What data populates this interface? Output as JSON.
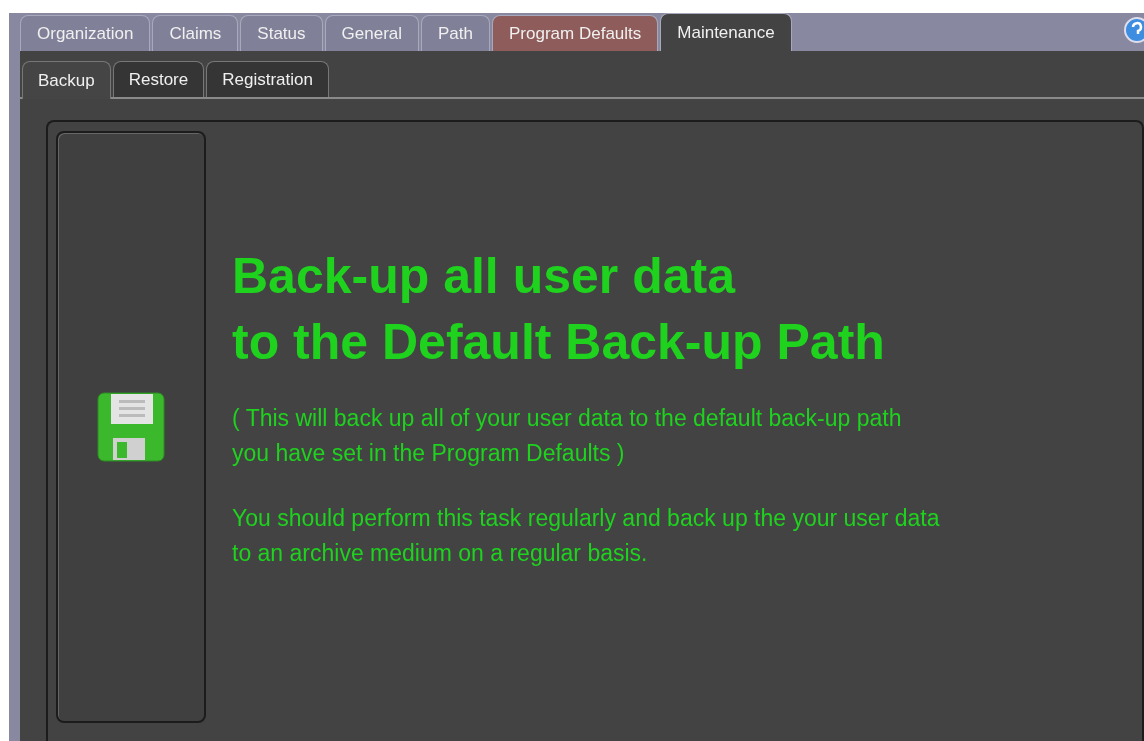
{
  "tabs": [
    {
      "label": "Organization",
      "selected": false,
      "highlighted": false
    },
    {
      "label": "Claims",
      "selected": false,
      "highlighted": false
    },
    {
      "label": "Status",
      "selected": false,
      "highlighted": false
    },
    {
      "label": "General",
      "selected": false,
      "highlighted": false
    },
    {
      "label": "Path",
      "selected": false,
      "highlighted": false
    },
    {
      "label": "Program Defaults",
      "selected": false,
      "highlighted": true
    },
    {
      "label": "Maintenance",
      "selected": true,
      "highlighted": false
    }
  ],
  "subtabs": [
    {
      "label": "Backup",
      "selected": true
    },
    {
      "label": "Restore",
      "selected": false
    },
    {
      "label": "Registration",
      "selected": false
    }
  ],
  "panel": {
    "heading_lines": [
      "Back-up all user data",
      "to the Default Back-up Path"
    ],
    "paragraphs": [
      [
        "( This will back up all of your user data to the  default back-up path",
        "you have set in the Program Defaults )"
      ],
      [
        "You should perform this task regularly and back up the your user data",
        "to an archive medium on a regular basis."
      ]
    ]
  }
}
